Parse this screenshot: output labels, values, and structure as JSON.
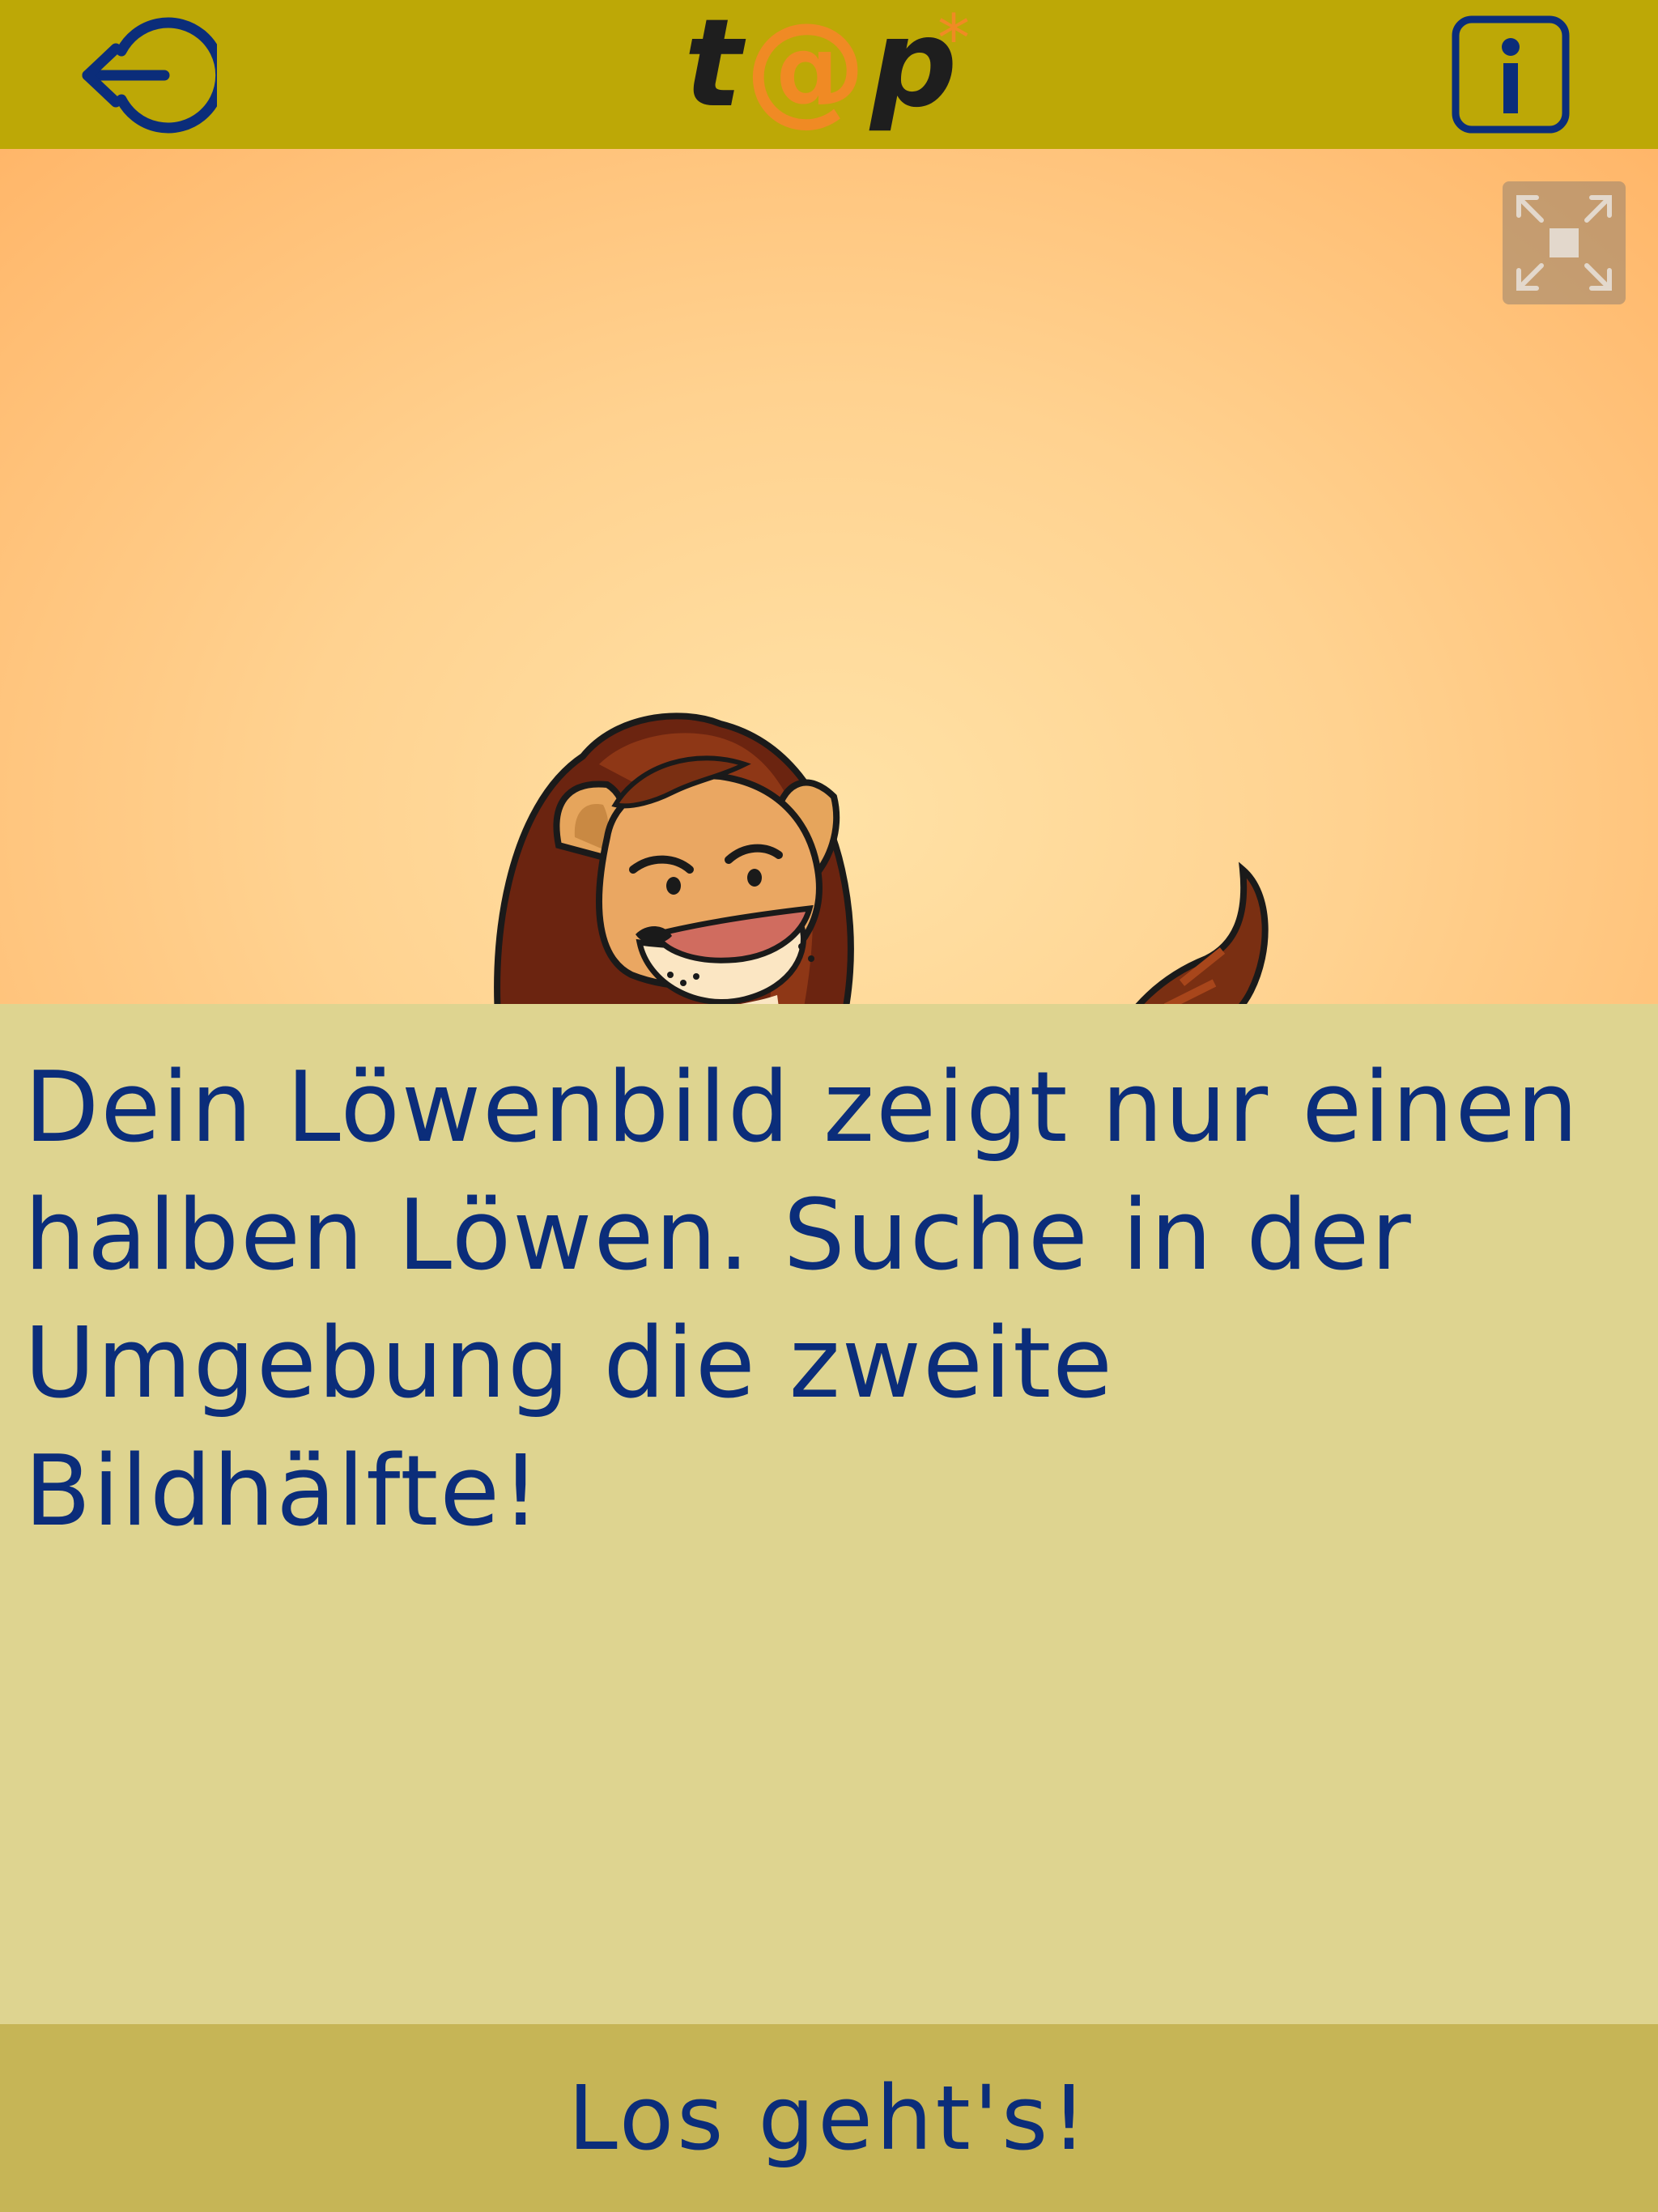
{
  "header": {
    "logo_text": "t@p*",
    "logout_icon": "logout-icon",
    "info_icon": "info-icon"
  },
  "hero": {
    "fullscreen_icon": "fullscreen-icon",
    "image": "lion-illustration"
  },
  "content": {
    "instruction": "Dein Löwenbild zeigt nur einen halben Löwen. Suche in der Umgebung die zweite Bildhälfte!"
  },
  "footer": {
    "start_label": "Los geht's!"
  },
  "colors": {
    "header_bg": "#bda806",
    "content_bg": "#ded490",
    "footer_bg": "#c6b556",
    "text_blue": "#0b2d7a",
    "logo_orange": "#f08a24"
  }
}
